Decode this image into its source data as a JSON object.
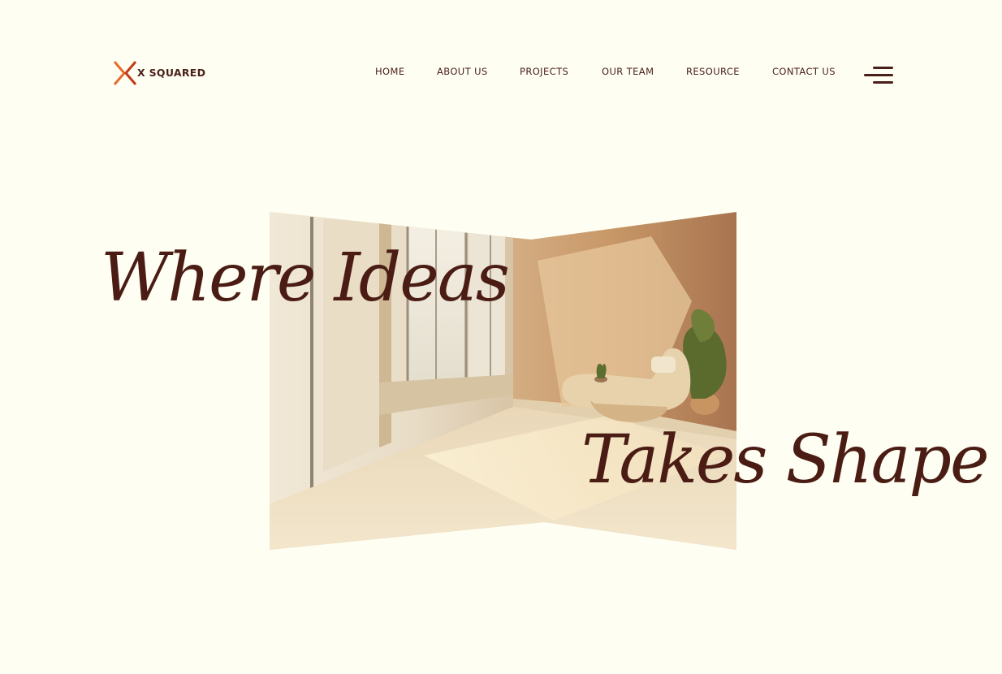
{
  "brand": {
    "name": "X SQUARED",
    "mark_colors": [
      "#e66a2c",
      "#c23a14"
    ]
  },
  "nav": {
    "items": [
      {
        "label": "HOME"
      },
      {
        "label": "ABOUT US"
      },
      {
        "label": "PROJECTS"
      },
      {
        "label": "OUR TEAM"
      },
      {
        "label": "RESOURCE"
      },
      {
        "label": "CONTACT US"
      }
    ],
    "menu_icon": "hamburger-menu-icon"
  },
  "hero": {
    "line1": "Where Ideas",
    "line2": "Takes Shape",
    "image_description": "sunlit minimalist interior with lounge chair and plant"
  },
  "colors": {
    "background": "#fefef2",
    "text": "#4a1c14",
    "accent": "#e66a2c"
  }
}
